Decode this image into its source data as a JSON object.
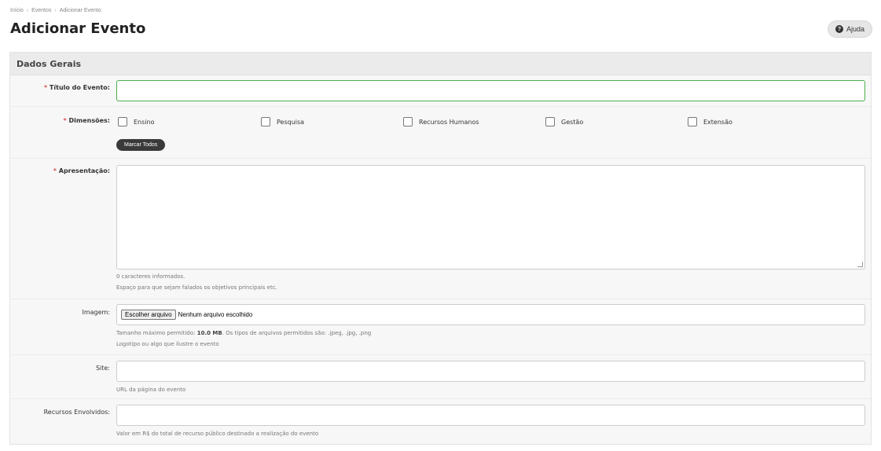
{
  "breadcrumb": {
    "home": "Início",
    "section": "Eventos",
    "current": "Adicionar Evento",
    "separator": "›"
  },
  "page": {
    "title": "Adicionar Evento",
    "help_label": "Ajuda",
    "help_icon": "question-circle-icon"
  },
  "panel": {
    "title": "Dados Gerais",
    "required_marker": "*",
    "fields": {
      "title": {
        "label": "Título do Evento:",
        "value": ""
      },
      "dimensions": {
        "label": "Dimensões:",
        "options": [
          "Ensino",
          "Pesquisa",
          "Recursos Humanos",
          "Gestão",
          "Extensão"
        ],
        "mark_all": "Marcar Todos"
      },
      "presentation": {
        "label": "Apresentação:",
        "value": "",
        "counter": "0 caracteres informados.",
        "hint": "Espaço para que sejam falados os objetivos principais etc."
      },
      "image": {
        "label": "Imagem:",
        "button": "Escolher arquivo",
        "status": "Nenhum arquivo escolhido",
        "hint_prefix": "Tamanho máximo permitido:",
        "hint_size": "10.0 MB",
        "hint_suffix": ". Os tipos de arquivos permitidos são: .jpeg, .jpg, .png",
        "hint2": "Logotipo ou algo que ilustre o evento"
      },
      "site": {
        "label": "Site:",
        "value": "",
        "hint": "URL da página do evento"
      },
      "resources": {
        "label": "Recursos Envolvidos:",
        "value": "",
        "hint": "Valor em R$ do total de recurso público destinado a realização do evento"
      }
    }
  }
}
